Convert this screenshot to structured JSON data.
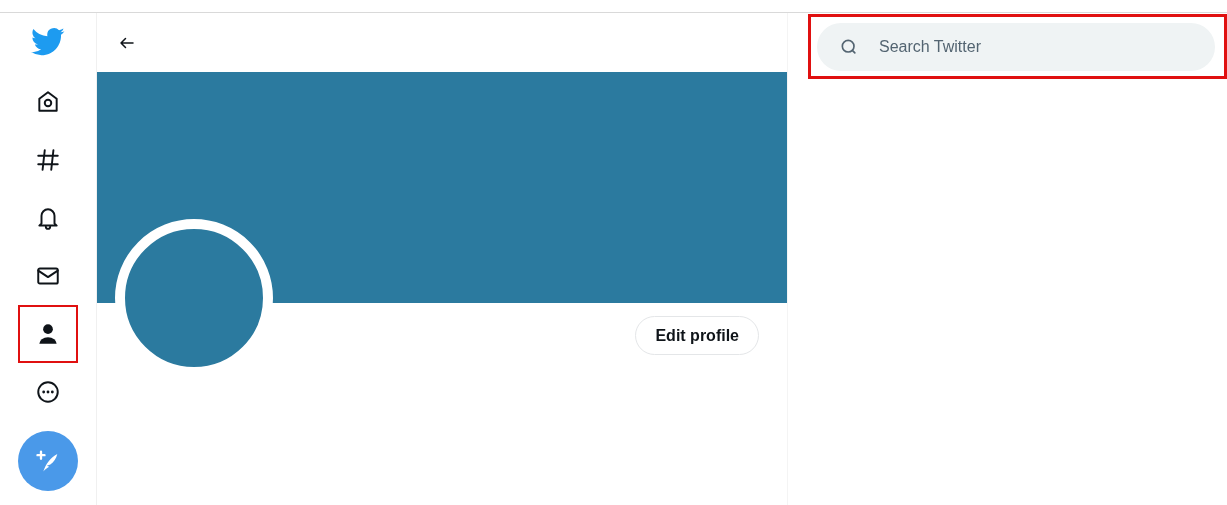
{
  "sidebar": {
    "items": [
      {
        "kind": "home",
        "selected": false,
        "highlighted": false
      },
      {
        "kind": "explore",
        "selected": false,
        "highlighted": false
      },
      {
        "kind": "notifications",
        "selected": false,
        "highlighted": false
      },
      {
        "kind": "messages",
        "selected": false,
        "highlighted": false
      },
      {
        "kind": "profile",
        "selected": true,
        "highlighted": true
      },
      {
        "kind": "more",
        "selected": false,
        "highlighted": false
      }
    ]
  },
  "profile": {
    "edit_button": "Edit profile"
  },
  "search": {
    "placeholder": "Search Twitter",
    "highlighted": true
  }
}
